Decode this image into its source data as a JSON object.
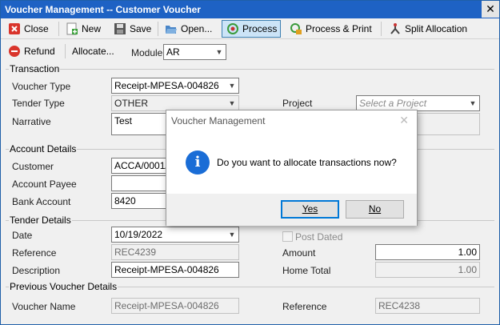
{
  "window": {
    "title": "Voucher Management -- Customer Voucher",
    "close_glyph": "✕"
  },
  "toolbar": {
    "close": "Close",
    "new": "New",
    "save": "Save",
    "open": "Open...",
    "process": "Process",
    "process_print": "Process & Print",
    "split": "Split Allocation",
    "refund": "Refund",
    "allocate": "Allocate...",
    "module_label": "Module",
    "module_value": "AR"
  },
  "transaction": {
    "group": "Transaction",
    "voucher_type_label": "Voucher Type",
    "voucher_type": "Receipt-MPESA-004826",
    "tender_type_label": "Tender Type",
    "tender_type": "OTHER",
    "narrative_label": "Narrative",
    "narrative": "Test",
    "project_label": "Project",
    "project_placeholder": "Select a Project"
  },
  "account": {
    "group": "Account Details",
    "customer_label": "Customer",
    "customer": "ACCA/0001/2",
    "payee_label": "Account Payee",
    "payee": "",
    "bank_label": "Bank Account",
    "bank": "8420"
  },
  "tender": {
    "group": "Tender Details",
    "date_label": "Date",
    "date": "10/19/2022",
    "reference_label": "Reference",
    "reference": "REC4239",
    "description_label": "Description",
    "description": "Receipt-MPESA-004826",
    "post_dated_label": "Post Dated",
    "amount_label": "Amount",
    "amount": "1.00",
    "home_total_label": "Home Total",
    "home_total": "1.00"
  },
  "previous": {
    "group": "Previous Voucher Details",
    "name_label": "Voucher Name",
    "name": "Receipt-MPESA-004826",
    "reference_label": "Reference",
    "reference": "REC4238"
  },
  "dialog": {
    "title": "Voucher Management",
    "icon_glyph": "i",
    "message": "Do you want to allocate transactions now?",
    "yes": "Yes",
    "no": "No"
  },
  "icons": [
    "close-icon",
    "new-icon",
    "save-icon",
    "open-icon",
    "process-icon",
    "process-print-icon",
    "split-allocation-icon",
    "refund-icon",
    "info-icon"
  ]
}
